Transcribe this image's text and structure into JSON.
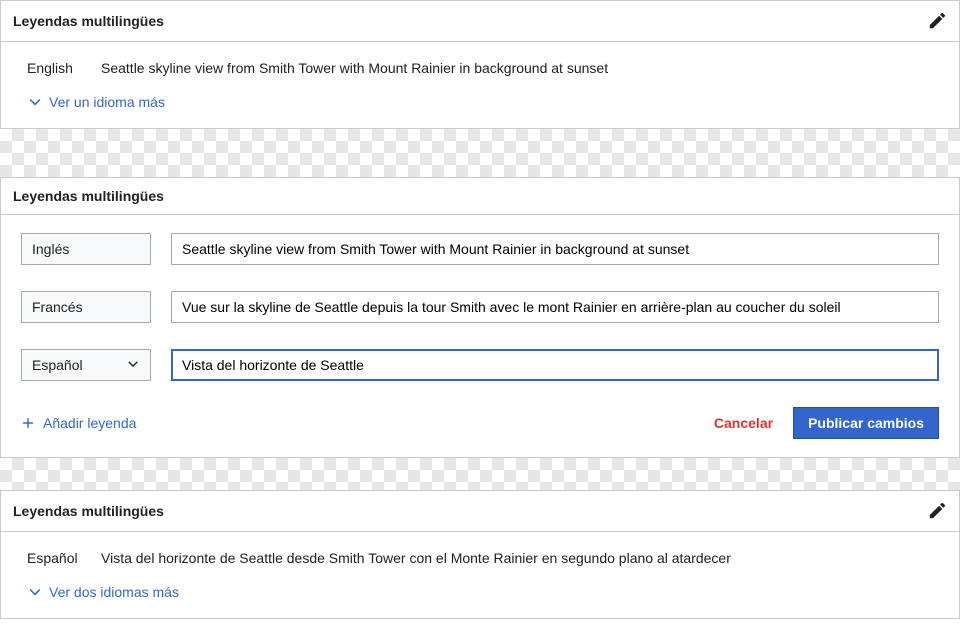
{
  "panel1": {
    "title": "Leyendas multilingües",
    "lang_label": "English",
    "caption": "Seattle skyline view from Smith Tower with Mount Rainier in background at sunset",
    "more_link": "Ver un idioma más"
  },
  "panel2": {
    "title": "Leyendas multilingües",
    "rows": [
      {
        "lang": "Inglés",
        "value": "Seattle skyline view from Smith Tower with Mount Rainier in background at sunset",
        "has_arrow": false,
        "focused": false
      },
      {
        "lang": "Francés",
        "value": "Vue sur la skyline de Seattle depuis la tour Smith avec le mont Rainier en arrière-plan au coucher du soleil",
        "has_arrow": false,
        "focused": false
      },
      {
        "lang": "Español",
        "value": "Vista del horizonte de Seattle",
        "has_arrow": true,
        "focused": true
      }
    ],
    "add_caption": "Añadir leyenda",
    "cancel": "Cancelar",
    "publish": "Publicar cambios"
  },
  "panel3": {
    "title": "Leyendas multilingües",
    "lang_label": "Español",
    "caption": "Vista del horizonte de Seattle desde Smith Tower con el Monte Rainier en segundo plano al atardecer",
    "more_link": "Ver dos idiomas más"
  }
}
